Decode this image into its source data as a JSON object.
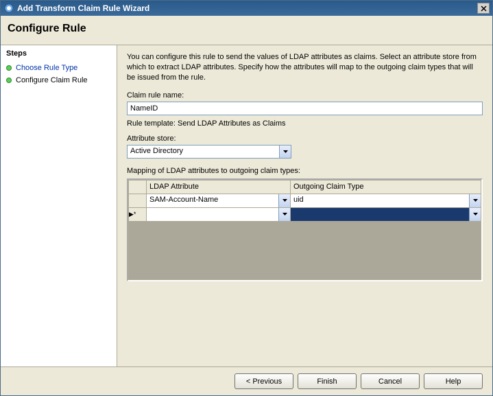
{
  "window": {
    "title": "Add Transform Claim Rule Wizard"
  },
  "header": {
    "title": "Configure Rule"
  },
  "sidebar": {
    "title": "Steps",
    "items": [
      {
        "label": "Choose Rule Type"
      },
      {
        "label": "Configure Claim Rule"
      }
    ]
  },
  "main": {
    "description": "You can configure this rule to send the values of LDAP attributes as claims. Select an attribute store from which to extract LDAP attributes. Specify how the attributes will map to the outgoing claim types that will be issued from the rule.",
    "rule_name_label": "Claim rule name:",
    "rule_name_value": "NameID",
    "template_text": "Rule template: Send LDAP Attributes as Claims",
    "attr_store_label": "Attribute store:",
    "attr_store_value": "Active Directory",
    "mapping_label": "Mapping of LDAP attributes to outgoing claim types:",
    "grid": {
      "col1": "LDAP Attribute",
      "col2": "Outgoing Claim Type",
      "rows": [
        {
          "ldap": "SAM-Account-Name",
          "claim": "uid"
        },
        {
          "ldap": "",
          "claim": ""
        }
      ]
    }
  },
  "footer": {
    "previous": "< Previous",
    "finish": "Finish",
    "cancel": "Cancel",
    "help": "Help"
  }
}
